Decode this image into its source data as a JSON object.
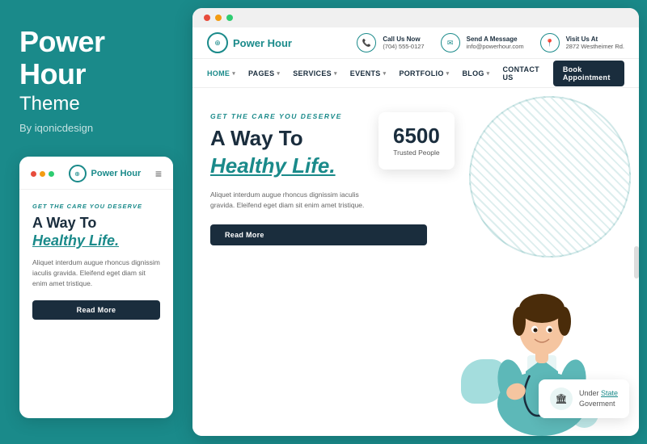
{
  "left": {
    "brand_line1": "Power",
    "brand_line2": "Hour",
    "brand_sub": "Theme",
    "brand_by": "By iqonicdesign"
  },
  "mobile": {
    "dots": [
      "red",
      "yellow",
      "green"
    ],
    "logo_text": "Power",
    "logo_span": "Hour",
    "hamburger": "≡",
    "eyebrow": "GET THE CARE YOU DESERVE",
    "heading1": "A Way To",
    "heading2": "Healthy Life.",
    "body": "Aliquet interdum augue rhoncus dignissim iaculis gravida. Eleifend eget diam sit enim amet tristique.",
    "cta": "Read More"
  },
  "desktop": {
    "info_bar": {
      "logo_text": "Power",
      "logo_span": "Hour",
      "contacts": [
        {
          "icon": "📞",
          "label": "Call Us Now",
          "value": "(704) 555-0127"
        },
        {
          "icon": "✉",
          "label": "Send A Message",
          "value": "info@powerhour.com"
        },
        {
          "icon": "📍",
          "label": "Visit Us At",
          "value": "2872 Westheimer Rd."
        }
      ]
    },
    "nav": {
      "items": [
        {
          "label": "HOME",
          "has_arrow": true
        },
        {
          "label": "PAGES",
          "has_arrow": true
        },
        {
          "label": "SERVICES",
          "has_arrow": true
        },
        {
          "label": "EVENTS",
          "has_arrow": true
        },
        {
          "label": "PORTFOLIO",
          "has_arrow": true
        },
        {
          "label": "BLOG",
          "has_arrow": true
        },
        {
          "label": "CONTACT US",
          "has_arrow": false
        }
      ],
      "cta": "Book Appointment"
    },
    "hero": {
      "eyebrow": "GET THE CARE YOU DESERVE",
      "heading1": "A Way To",
      "heading2": "Healthy Life.",
      "body": "Aliquet interdum augue rhoncus dignissim iaculis gravida. Eleifend eget diam sit enim amet tristique.",
      "cta": "Read More",
      "stats": {
        "number": "6500",
        "label": "Trusted People"
      },
      "gov_card": {
        "label1": "Under",
        "link": "State",
        "label2": "Goverment"
      }
    }
  }
}
